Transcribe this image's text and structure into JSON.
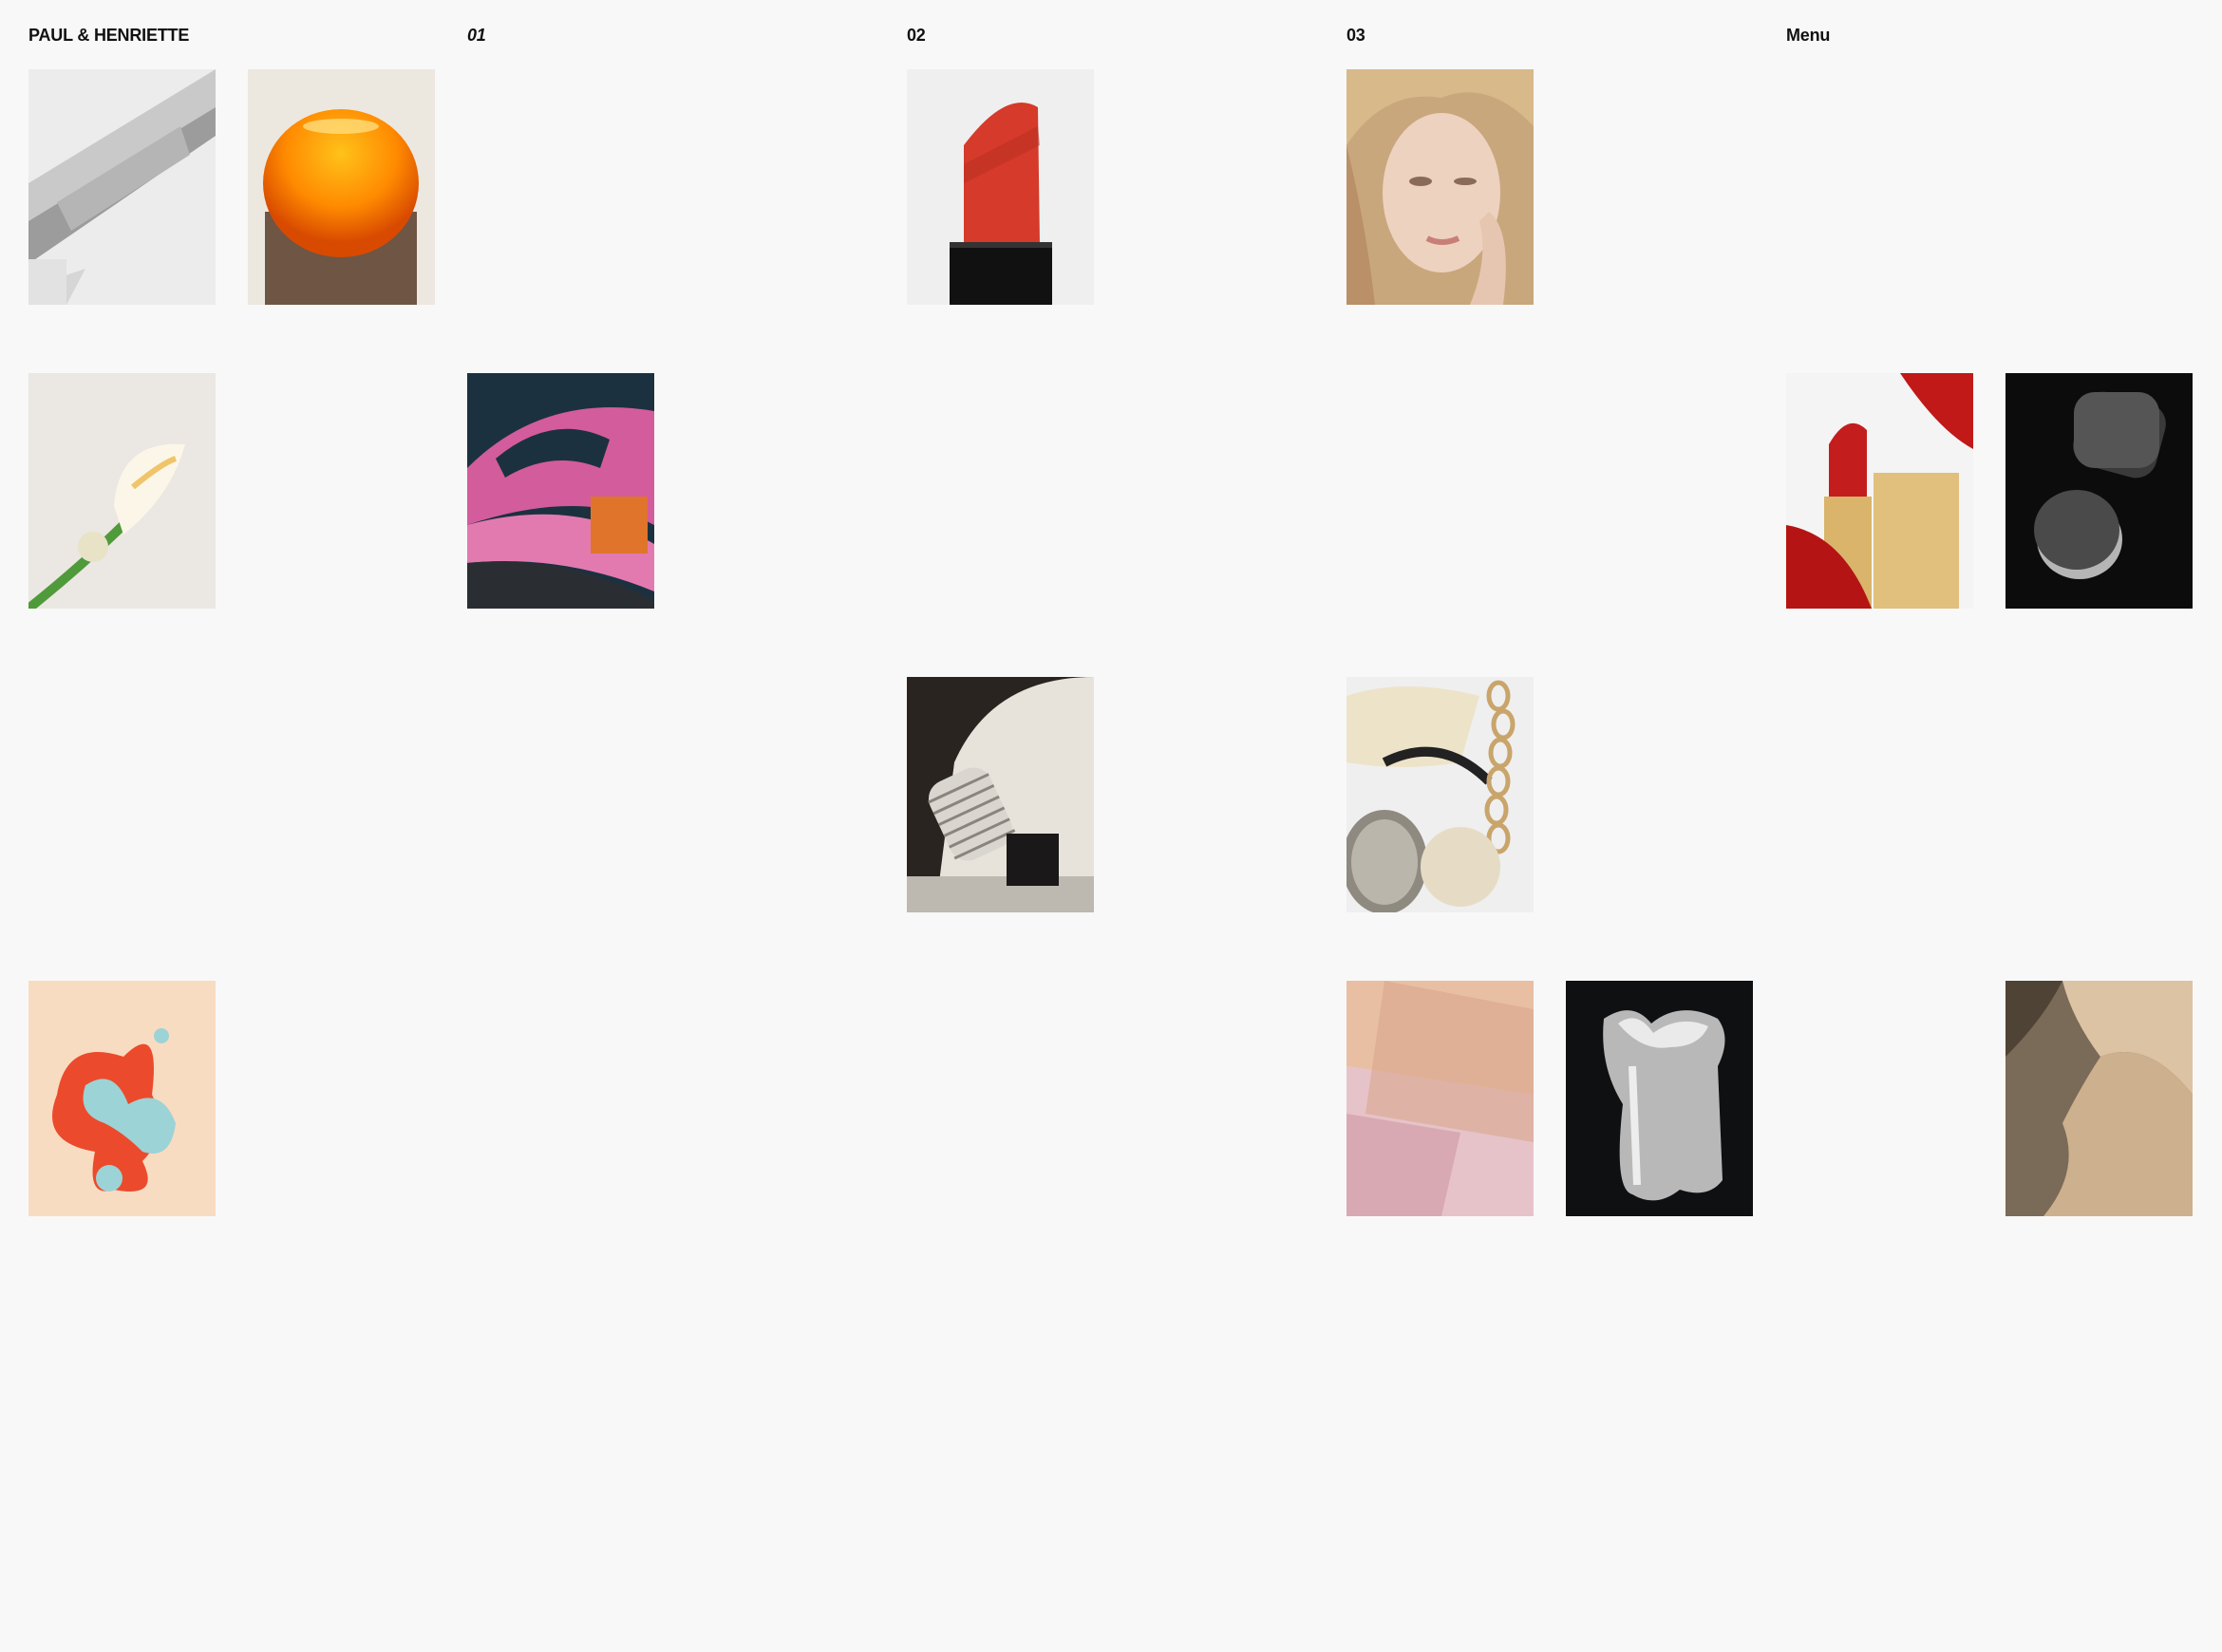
{
  "brand": "PAUL & HENRIETTE",
  "nav": {
    "item_01": "01",
    "item_02": "02",
    "item_03": "03",
    "menu": "Menu"
  },
  "colors": {
    "background": "#f8f8f8",
    "text": "#111111"
  },
  "gallery": [
    {
      "name": "file-tool"
    },
    {
      "name": "orange-sphere"
    },
    {
      "name": "red-lipstick"
    },
    {
      "name": "woman-portrait"
    },
    {
      "name": "calla-lily"
    },
    {
      "name": "pink-sandal"
    },
    {
      "name": "gold-lipstick-petals"
    },
    {
      "name": "black-sponges"
    },
    {
      "name": "ribbed-bottle"
    },
    {
      "name": "sandal-shells-chain"
    },
    {
      "name": "paint-blobs"
    },
    {
      "name": "powder-swatches"
    },
    {
      "name": "silver-vase"
    },
    {
      "name": "beige-fabric"
    }
  ]
}
